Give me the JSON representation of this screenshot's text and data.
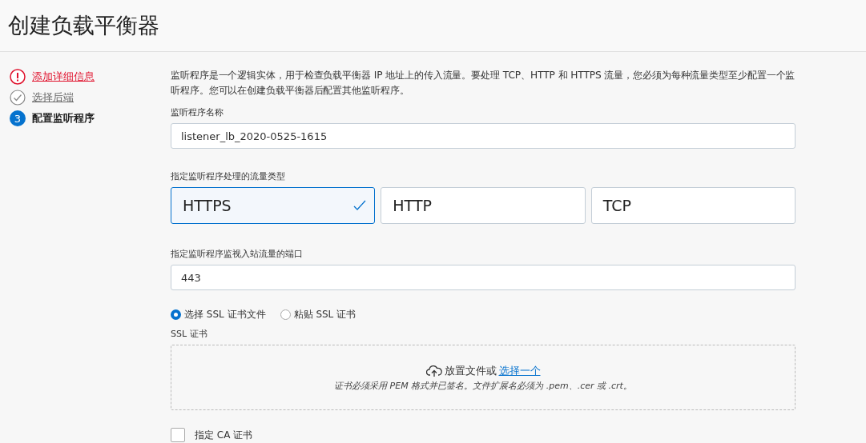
{
  "title": "创建负载平衡器",
  "steps": [
    {
      "label": "添加详细信息",
      "kind": "error"
    },
    {
      "label": "选择后端",
      "kind": "done"
    },
    {
      "label": "配置监听程序",
      "kind": "current",
      "number": "3"
    }
  ],
  "intro": "监听程序是一个逻辑实体，用于检查负载平衡器 IP 地址上的传入流量。要处理 TCP、HTTP 和 HTTPS 流量，您必须为每种流量类型至少配置一个监听程序。您可以在创建负载平衡器后配置其他监听程序。",
  "name_field": {
    "label": "监听程序名称",
    "value": "listener_lb_2020-0525-1615"
  },
  "traffic_type": {
    "label": "指定监听程序处理的流量类型",
    "options": [
      {
        "label": "HTTPS",
        "selected": true
      },
      {
        "label": "HTTP",
        "selected": false
      },
      {
        "label": "TCP",
        "selected": false
      }
    ]
  },
  "port_field": {
    "label": "指定监听程序监视入站流量的端口",
    "value": "443"
  },
  "cert_source": [
    {
      "label": "选择 SSL 证书文件",
      "selected": true
    },
    {
      "label": "粘贴 SSL 证书",
      "selected": false
    }
  ],
  "ssl_cert": {
    "label": "SSL 证书",
    "drop_text": "放置文件或",
    "link": "选择一个",
    "hint": "证书必须采用 PEM 格式并已签名。文件扩展名必须为 .pem、.cer 或 .crt。"
  },
  "ca_cert": {
    "label": "指定 CA 证书",
    "checked": false
  }
}
